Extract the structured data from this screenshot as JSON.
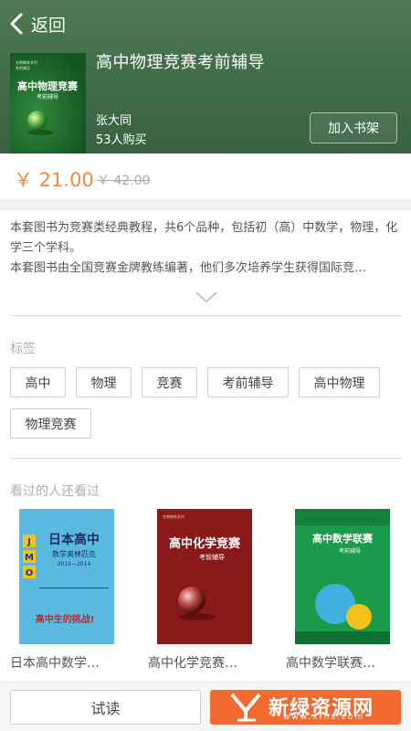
{
  "header": {
    "back_label": "返回",
    "title": "高中物理竞赛考前辅导",
    "author": "张大同",
    "buyers": "53人购买",
    "add_to_shelf_label": "加入书架",
    "cover": {
      "title": "高中物理竞赛",
      "subtitle": "考前辅导"
    }
  },
  "price": {
    "current": "￥ 21.00",
    "original": "￥ 42.00",
    "accent_color": "#f08a3c"
  },
  "description": {
    "lines": [
      "本套图书为竞赛类经典教程，共6个品种，包括初（高）中数学，物理，化学三个学科。",
      "本套图书由全国竞赛金牌教练编著，他们多次培养学生获得国际竞…"
    ],
    "expand_icon": "chevron-down-icon"
  },
  "tags": {
    "title": "标签",
    "items": [
      "高中",
      "物理",
      "竞赛",
      "考前辅导",
      "高中物理",
      "物理竞赛"
    ]
  },
  "recommended": {
    "title": "看过的人还看过",
    "items": [
      {
        "label": "日本高中数学…",
        "cover_title": "日本高中",
        "cover_subtitle": "数学奥林匹克",
        "cover_years": "2010—2014",
        "cover_slogan": "高中生的挑战!",
        "letters": [
          "J",
          "M",
          "O"
        ]
      },
      {
        "label": "高中化学竞赛…",
        "cover_title": "高中化学竞赛",
        "cover_subtitle": "考前辅导"
      },
      {
        "label": "高中数学联赛…",
        "cover_title": "高中数学联赛",
        "cover_subtitle": "考前辅导"
      }
    ]
  },
  "bottom": {
    "trial_label": "试读",
    "watermark": "新绿资源网",
    "watermark_url": "www.xfhs.com"
  }
}
